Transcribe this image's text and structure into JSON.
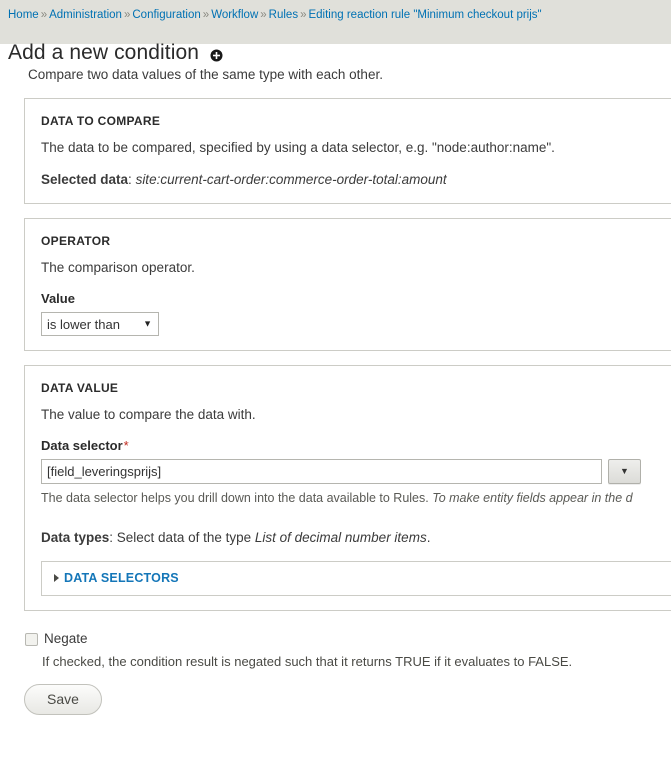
{
  "breadcrumb": {
    "separator": "»",
    "items": [
      {
        "label": "Home"
      },
      {
        "label": "Administration"
      },
      {
        "label": "Configuration"
      },
      {
        "label": "Workflow"
      },
      {
        "label": "Rules"
      },
      {
        "label": "Editing reaction rule \"Minimum checkout prijs\""
      }
    ]
  },
  "header": {
    "title": "Add a new condition",
    "add_icon": "plus-circle-icon"
  },
  "main": {
    "intro": "Compare two data values of the same type with each other."
  },
  "data_to_compare": {
    "legend": "DATA TO COMPARE",
    "description": "The data to be compared, specified by using a data selector, e.g. \"node:author:name\".",
    "selected_data_label": "Selected data",
    "selected_data_sep": ": ",
    "selected_data_value": "site:current-cart-order:commerce-order-total:amount"
  },
  "operator": {
    "legend": "OPERATOR",
    "description": "The comparison operator.",
    "value_label": "Value",
    "selected_value": "is lower than",
    "options": [
      "is lower than"
    ],
    "arrow_icon": "chevron-down-icon"
  },
  "data_value": {
    "legend": "DATA VALUE",
    "description": "The value to compare the data with.",
    "selector_label": "Data selector",
    "required_marker": "*",
    "selector_value": "[field_leveringsprijs]",
    "selector_placeholder": "",
    "dropdown_icon": "chevron-down-icon",
    "help_text_plain": "The data selector helps you drill down into the data available to Rules. ",
    "help_text_italic": "To make entity fields appear in the d",
    "data_types_label": "Data types",
    "data_types_sep": ": Select data of the type ",
    "data_types_value": "List of decimal number items",
    "data_types_end": ".",
    "data_selectors_disclosure": "DATA SELECTORS"
  },
  "negate": {
    "label": "Negate",
    "checked": false,
    "description": "If checked, the condition result is negated such that it returns TRUE if it evaluates to FALSE."
  },
  "actions": {
    "save_label": "Save"
  },
  "colors": {
    "header_bg": "#e0e0da",
    "link": "#0071b3",
    "disclosure_link": "#1476b8",
    "required": "#c0281c",
    "border": "#ccccc6"
  }
}
